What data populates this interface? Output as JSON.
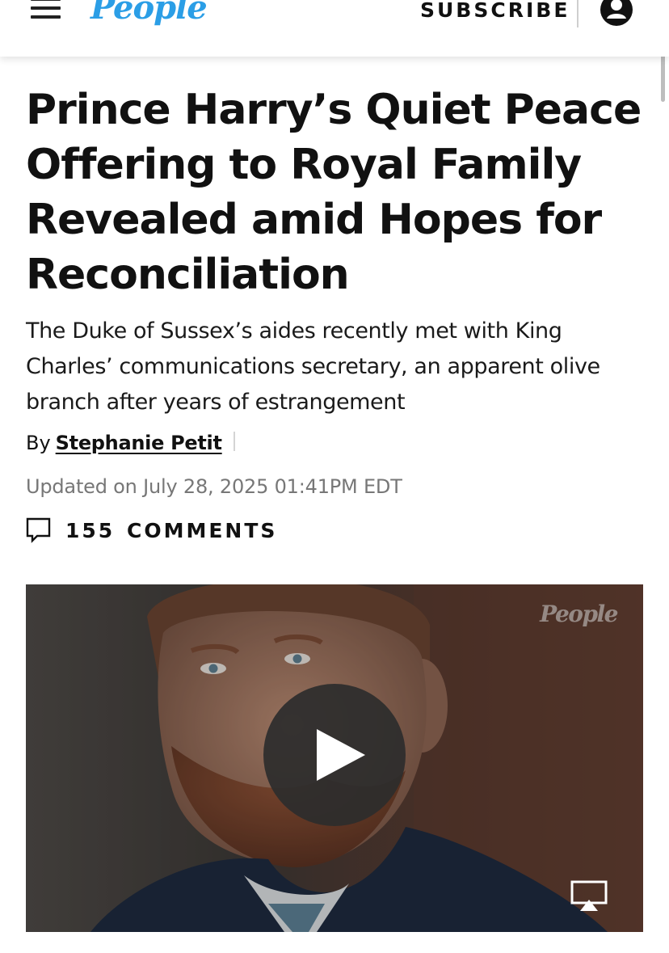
{
  "header": {
    "logo": "People",
    "subscribe_label": "SUBSCRIBE",
    "icons": {
      "menu": "hamburger-menu-icon",
      "account": "user-account-icon"
    },
    "brand_color": "#2b9ee6"
  },
  "article": {
    "headline": "Prince Harry’s Quiet Peace Offering to Royal Family Revealed amid Hopes for Reconciliation",
    "dek": "The Duke of Sussex’s aides recently met with King Charles’ communications secretary, an apparent olive branch after years of estrangement",
    "byline_prefix": "By",
    "author": "Stephanie Petit",
    "updated": "Updated on July 28, 2025 01:41PM EDT",
    "comments": {
      "count": "155",
      "label": "COMMENTS",
      "icon": "comment-bubble-icon"
    }
  },
  "video": {
    "watermark": "People",
    "icons": {
      "play": "play-icon",
      "airplay": "airplay-icon"
    }
  }
}
